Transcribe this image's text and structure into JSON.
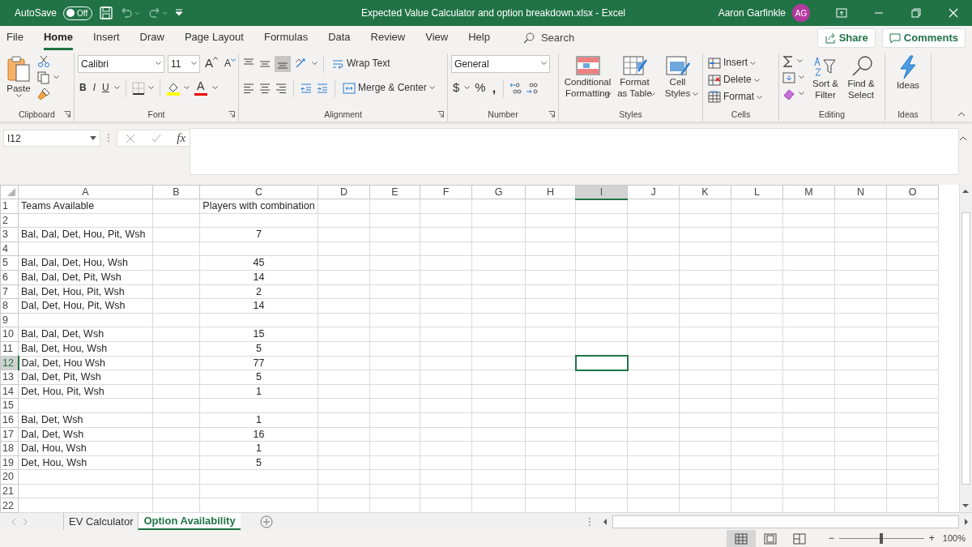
{
  "title_bar": {
    "autosave_label": "AutoSave",
    "autosave": {
      "label": "Off",
      "on": false
    },
    "title": "Expected Value Calculator and option breakdown.xlsx  -  Excel",
    "user_name": "Aaron Garfinkle",
    "user_initials": "AG"
  },
  "menu_tabs": [
    {
      "label": "File",
      "selected": false
    },
    {
      "label": "Home",
      "selected": true
    },
    {
      "label": "Insert",
      "selected": false
    },
    {
      "label": "Draw",
      "selected": false
    },
    {
      "label": "Page Layout",
      "selected": false
    },
    {
      "label": "Formulas",
      "selected": false
    },
    {
      "label": "Data",
      "selected": false
    },
    {
      "label": "Review",
      "selected": false
    },
    {
      "label": "View",
      "selected": false
    },
    {
      "label": "Help",
      "selected": false
    }
  ],
  "search": {
    "placeholder": "Search"
  },
  "share": "Share",
  "comments": "Comments",
  "ribbon": {
    "clipboard": {
      "paste": "Paste",
      "label": "Clipboard"
    },
    "font": {
      "name": "Calibri",
      "size": "11",
      "grow": "A",
      "shrink": "A",
      "bold": "B",
      "italic": "I",
      "underline": "U",
      "color_letter": "A",
      "label": "Font"
    },
    "alignment": {
      "wrap": "Wrap Text",
      "merge": "Merge & Center",
      "label": "Alignment"
    },
    "number": {
      "format": "General",
      "currency": "$",
      "percent": "%",
      "comma": ",",
      "label": "Number"
    },
    "styles": {
      "buttons": [
        "Conditional Formatting",
        "Format as Table",
        "Cell Styles"
      ],
      "label": "Styles"
    },
    "cells": {
      "buttons": [
        "Insert",
        "Delete",
        "Format"
      ],
      "label": "Cells"
    },
    "editing": {
      "buttons": [
        "Sort & Filter",
        "Find & Select"
      ],
      "label": "Editing"
    },
    "ideas": {
      "button": "Ideas",
      "label": "Ideas"
    }
  },
  "formula_bar": {
    "name_box": "I12",
    "fx": "fx"
  },
  "sheet": {
    "columns": [
      {
        "label": "A",
        "selected": false
      },
      {
        "label": "B",
        "selected": false
      },
      {
        "label": "C",
        "selected": false
      },
      {
        "label": "D",
        "selected": false
      },
      {
        "label": "E",
        "selected": false
      },
      {
        "label": "F",
        "selected": false
      },
      {
        "label": "G",
        "selected": false
      },
      {
        "label": "H",
        "selected": false
      },
      {
        "label": "I",
        "selected": true
      },
      {
        "label": "J",
        "selected": false
      },
      {
        "label": "K",
        "selected": false
      },
      {
        "label": "L",
        "selected": false
      },
      {
        "label": "M",
        "selected": false
      },
      {
        "label": "N",
        "selected": false
      },
      {
        "label": "O",
        "selected": false
      }
    ],
    "rows": [
      {
        "label": "1",
        "selected": false,
        "column_a": "Teams Available",
        "column_c": "Players with combination"
      },
      {
        "label": "2",
        "selected": false
      },
      {
        "label": "3",
        "selected": false,
        "column_a": "Bal, Dal, Det, Hou, Pit, Wsh",
        "column_c": "7"
      },
      {
        "label": "4",
        "selected": false
      },
      {
        "label": "5",
        "selected": false,
        "column_a": "Bal, Dal, Det, Hou, Wsh",
        "column_c": "45"
      },
      {
        "label": "6",
        "selected": false,
        "column_a": "Bal, Dal, Det, Pit, Wsh",
        "column_c": "14"
      },
      {
        "label": "7",
        "selected": false,
        "column_a": "Bal, Det, Hou, Pit, Wsh",
        "column_c": "2"
      },
      {
        "label": "8",
        "selected": false,
        "column_a": "Dal, Det, Hou, Pit, Wsh",
        "column_c": "14"
      },
      {
        "label": "9",
        "selected": false
      },
      {
        "label": "10",
        "selected": false,
        "column_a": "Bal, Dal, Det, Wsh",
        "column_c": "15"
      },
      {
        "label": "11",
        "selected": false,
        "column_a": "Bal, Det, Hou, Wsh",
        "column_c": "5"
      },
      {
        "label": "12",
        "selected": true,
        "column_a": "Dal, Det, Hou Wsh",
        "column_c": "77"
      },
      {
        "label": "13",
        "selected": false,
        "column_a": "Dal, Det, Pit, Wsh",
        "column_c": "5"
      },
      {
        "label": "14",
        "selected": false,
        "column_a": "Det, Hou, Pit, Wsh",
        "column_c": "1"
      },
      {
        "label": "15",
        "selected": false
      },
      {
        "label": "16",
        "selected": false,
        "column_a": "Bal, Det, Wsh",
        "column_c": "1"
      },
      {
        "label": "17",
        "selected": false,
        "column_a": "Dal, Det, Wsh",
        "column_c": "16"
      },
      {
        "label": "18",
        "selected": false,
        "column_a": "Dal, Hou, Wsh",
        "column_c": "1"
      },
      {
        "label": "19",
        "selected": false,
        "column_a": "Det, Hou, Wsh",
        "column_c": "5"
      },
      {
        "label": "20",
        "selected": false
      },
      {
        "label": "21",
        "selected": false
      },
      {
        "label": "22",
        "selected": false
      }
    ]
  },
  "sheet_tabs": [
    {
      "label": "EV Calculator",
      "selected": false
    },
    {
      "label": "Option Availability",
      "selected": true
    }
  ],
  "status_bar": {
    "views": [
      {
        "kind": "normal",
        "selected": true
      },
      {
        "kind": "page_layout",
        "selected": false
      },
      {
        "kind": "page_break",
        "selected": false
      }
    ],
    "zoom": {
      "out": "−",
      "in": "+",
      "level": 0.5,
      "label": "100%"
    }
  }
}
